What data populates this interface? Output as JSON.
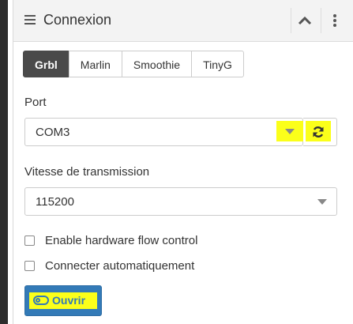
{
  "header": {
    "title": "Connexion",
    "icons": {
      "menu": "bars-icon",
      "collapse": "chevron-up-icon",
      "more": "more-vertical-icon"
    }
  },
  "tabs": [
    {
      "label": "Grbl",
      "active": true
    },
    {
      "label": "Marlin",
      "active": false
    },
    {
      "label": "Smoothie",
      "active": false
    },
    {
      "label": "TinyG",
      "active": false
    }
  ],
  "port": {
    "label": "Port",
    "selected": "COM3",
    "refresh_icon": "refresh-icon"
  },
  "baud": {
    "label": "Vitesse de transmission",
    "selected": "115200"
  },
  "options": {
    "flow_control": {
      "label": "Enable hardware flow control",
      "checked": false
    },
    "auto_connect": {
      "label": "Connecter automatiquement",
      "checked": false
    }
  },
  "open_button": {
    "label": "Ouvrir",
    "icon": "toggle-off-icon"
  },
  "colors": {
    "primary": "#337ab7",
    "highlight": "#fbff1a",
    "active_tab": "#4a4a4a"
  }
}
